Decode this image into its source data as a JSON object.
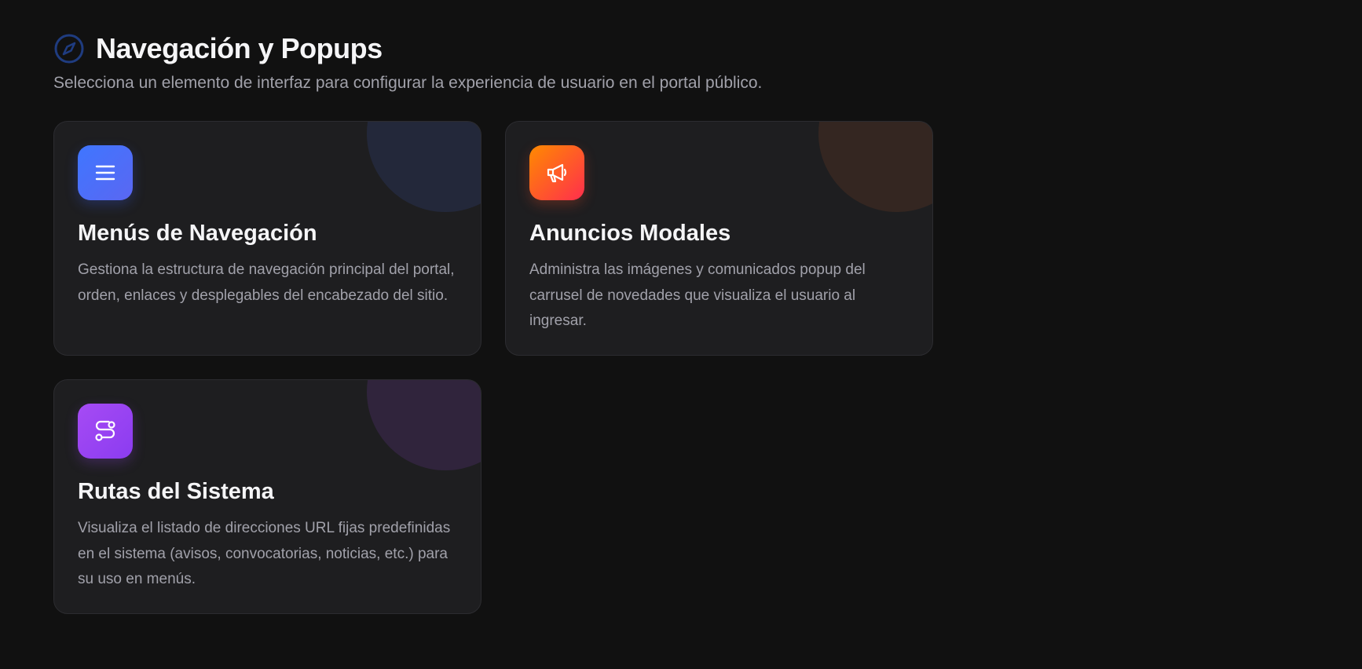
{
  "header": {
    "icon": "compass-icon",
    "title": "Navegación y Popups",
    "subtitle": "Selecciona un elemento de interfaz para configurar la experiencia de usuario en el portal público."
  },
  "cards": [
    {
      "icon": "menu-icon",
      "title": "Menús de Navegación",
      "description": "Gestiona la estructura de navegación principal del portal, orden, enlaces y desplegables del encabezado del sitio.",
      "accent": "#4a70ff"
    },
    {
      "icon": "megaphone-icon",
      "title": "Anuncios Modales",
      "description": "Administra las imágenes y comunicados popup del carrusel de novedades que visualiza el usuario al ingresar.",
      "accent": "#ff5a2a"
    },
    {
      "icon": "route-icon",
      "title": "Rutas del Sistema",
      "description": "Visualiza el listado de direcciones URL fijas predefinidas en el sistema (avisos, convocatorias, noticias, etc.) para su uso en menús.",
      "accent": "#a04cf4"
    }
  ],
  "colors": {
    "background": "#111111",
    "card_background": "#1e1e20",
    "title": "#f5f5f7",
    "muted_text": "#a1a1aa",
    "compass_accent": "#1e3a7a"
  }
}
